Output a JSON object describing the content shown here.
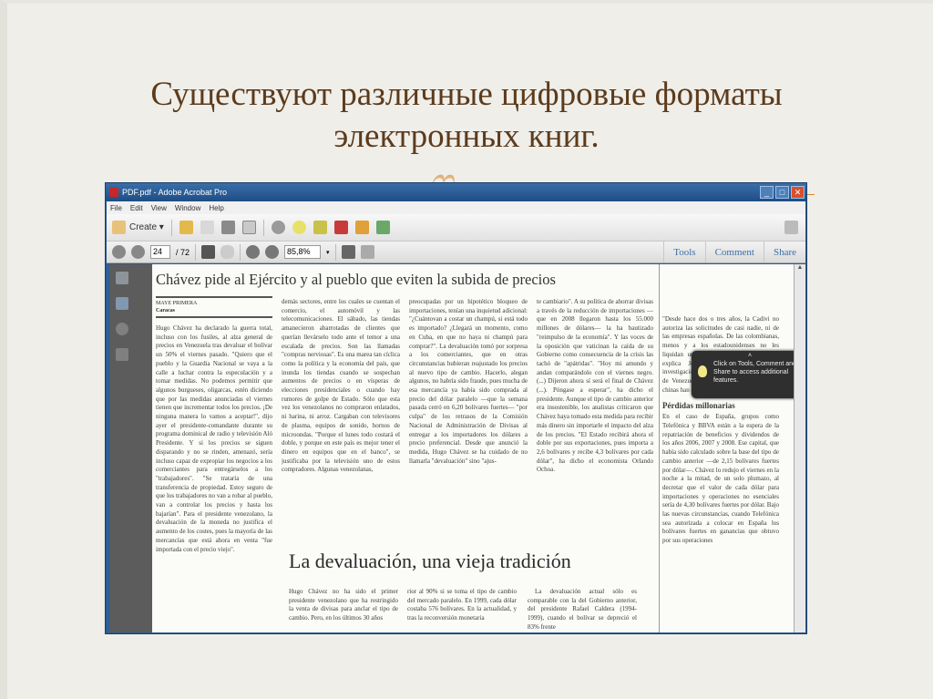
{
  "slide": {
    "title_line1": "Существуют различные цифровые форматы",
    "title_line2": "электронных книг."
  },
  "window": {
    "title": "PDF.pdf - Adobe Acrobat Pro",
    "menu": [
      "File",
      "Edit",
      "View",
      "Window",
      "Help"
    ],
    "create_label": "Create ▾",
    "page_current": "24",
    "page_total": "/ 72",
    "zoom": "85,8%",
    "tabs": [
      "Tools",
      "Comment",
      "Share"
    ],
    "tooltip": "Click on Tools, Comment and Share to access additional features."
  },
  "article": {
    "headline": "Chávez pide al Ejército y al pueblo que eviten la subida de precios",
    "author": "MAYE PRIMERA",
    "place": "Caracas",
    "col1": "Hugo Chávez ha declarado la guerra total, incluso con los fusiles, al alza general de precios en Venezuela tras devaluar el bolívar un 50% el viernes pasado. \"Quiero que el pueblo y la Guardia Nacional se vaya a la calle a luchar contra la especulación y a tomar medidas. No podemos permitir que algunos burgueses, oligarcas, estén diciendo que por las medidas anunciadas el viernes tienen que incrementar todos los precios. ¡De ninguna manera lo vamos a aceptar!\", dijo ayer el presidente-comandante durante su programa dominical de radio y televisión Aló Presidente. Y si los precios se siguen disparando y no se rinden, amenazó, sería incluso capaz de expropiar los negocios a los comerciantes para entregárselos a los \"trabajadores\". \"Se trataría de una transferencia de propiedad. Estoy seguro de que los trabajadores no van a robar al pueblo, van a controlar los precios y hasta los bajarían\". Para el presidente venezolano, la devaluación de la moneda no justifica el aumento de los costes, pues la mayoría de las mercancías que está ahora en venta \"fue importada con el precio viejo\".",
    "col2": "demás sectores, entre los cuales se cuentan el comercio, el automóvil y las telecomunicaciones. El sábado, las tiendas amanecieron abarrotadas de clientes que querían llevárselo todo ante el temor a una escalada de precios. Son las llamadas \"compras nerviosas\". Es una marea tan cíclica como la política y la economía del país, que inunda los tiendas cuando se sospechan aumentos de precios o en vísperas de elecciones presidenciales o cuando hay rumores de golpe de Estado. Sólo que esta vez los venezolanos no compraron enlatados, ni harina, ni arroz. Cargaban con televisores de plasma, equipos de sonido, hornos de microondas. \"Porque el lunes todo costará el doble, y porque en este país es mejor tener el dinero en equipos que en el banco\", se justificaba por la televisión uno de estos compradores. Algunas venezolanas,",
    "col3": "preocupadas por un hipotético bloqueo de importaciones, tenían una inquietud adicional: \"¿Cuántovan a costar un champú, si está todo es importado? ¿Llegará un momento, como en Cuba, en que no haya ni champú para comprar?\". La devaluación tomó por sorpresa a los comerciantes, que en otras circunstancias hubieran reajustado los precios al nuevo tipo de cambio. Hacerlo, alegan algunos, no habría sido fraude, pues mucha de esa mercancía ya había sido comprada al precio del dólar paralelo —que la semana pasada cerró en 6,20 bolívares fuertes— \"por culpa\" de los retrasos de la Comisión Nacional de Administración de Divisas al entregar a los importadores los dólares a precio preferencial. Desde que anunció la medida, Hugo Chávez se ha cuidado de no llamarla \"devaluación\" sino \"ajus-",
    "col4": "te cambiario\". A su política de ahorrar divisas a través de la reducción de importaciones —que en 2008 llegaron hasta los 55.000 millones de dólares— la ha bautizado \"reimpulso de la economía\". Y las voces de la oposición que vaticinan la caída de su Gobierno como consecuencia de la crisis las tachó de \"apátridas\". \"Hoy mi amundo y andan comparándolo con el viernes negro. (...) Dijeron ahora sí será el final de Chávez (...). Póngase a esperar\", ha dicho el presidente. Aunque el tipo de cambio anterior era insostenible, los analistas criticaron que Chávez haya tomado esta medida para recibir más dinero sin importarle el impacto del alza de los precios. \"El Estado recibirá ahora el doble por sus exportaciones, pues importa a 2,6 bolívares y recibe 4,3 bolívares por cada dólar\", ha dicho el economista Orlando Ochoa.",
    "col5a": "\"Desde hace dos o tres años, la Cadivi no autoriza las solicitudes de casi nadie, ni de las empresas españolas. De las colombianas, menos y a los estadounidenses no les liquidan un dólar desde hace tres años\", explica José Guerra, ex gerente de investigación económica del Banco Central de Venezuela. Las compañías brasileñas y chinas han corrido con mayor suerte.",
    "subhead": "Pérdidas millonarias",
    "col5b": "En el caso de España, grupos como Telefónica y BBVA están a la espera de la repatriación de beneficios y dividendos de los años 2006, 2007 y 2008. Ese capital, que había sido calculado sobre la base del tipo de cambio anterior —de 2,15 bolívares fuertes por dólar—. Chávez lo redujo el viernes en la noche a la mitad, de un solo plumazo, al decretar que el valor de cada dólar para importaciones y operaciones no esenciales sería de 4,30 bolívares fuertes por dólar. Bajo las nuevas circunstancias, cuando Telefónica sea autorizada a colocar en España los bolívares fuertes en ganancias que obtuvo por sus operaciones",
    "headline2": "La devaluación, una vieja tradición",
    "b1": "Hugo Chávez no ha sido el primer presidente venezolano que ha restringido la venta de divisas para anclar el tipo de cambio. Pero, en los últimos 30 años",
    "b2": "rior al 90% si se toma el tipo de cambio del mercado paralelo. En 1999, cada dólar costaba 576 bolívares. En la actualidad, y tras la reconversión monetaria",
    "b3": "La devaluación actual sólo es comparable con la del Gobierno anterior, del presidente Rafael Caldera (1994-1999), cuando el bolívar se depreció el 83% frente"
  }
}
